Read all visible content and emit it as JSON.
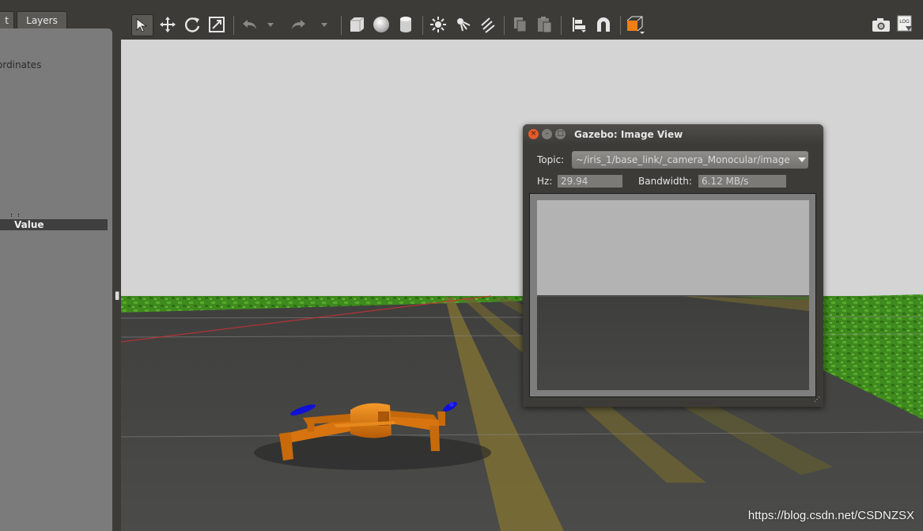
{
  "left_panel": {
    "tabs": [
      "t",
      "Layers"
    ],
    "property_label": "ordinates",
    "column_header": "Value"
  },
  "toolbar": {
    "tools": [
      "select-arrow-icon",
      "translate-icon",
      "rotate-icon",
      "scale-icon",
      "undo-icon",
      "dropdown-icon",
      "redo-icon",
      "dropdown-icon",
      "box-shape-icon",
      "sphere-shape-icon",
      "cylinder-shape-icon",
      "point-light-icon",
      "spot-light-icon",
      "directional-light-icon",
      "copy-icon",
      "paste-icon",
      "align-icon",
      "snap-icon",
      "view-angle-icon"
    ],
    "right_tools": [
      "screenshot-icon",
      "log-icon"
    ],
    "log_label": "LOG"
  },
  "dialog": {
    "title": "Gazebo: Image View",
    "topic_label": "Topic:",
    "topic_value": "~/iris_1/base_link/_camera_Monocular/image",
    "hz_label": "Hz:",
    "hz_value": "29.94",
    "bandwidth_label": "Bandwidth:",
    "bandwidth_value": "6.12 MB/s"
  },
  "watermark": "https://blog.csdn.net/CSDNZSX",
  "colors": {
    "drone_body": "#e07a10",
    "propeller": "#1010d8",
    "grass": "#3f8a1e",
    "runway": "#4a4a48",
    "sky": "#d2d2d2",
    "view_angle_accent": "#f07f12"
  }
}
